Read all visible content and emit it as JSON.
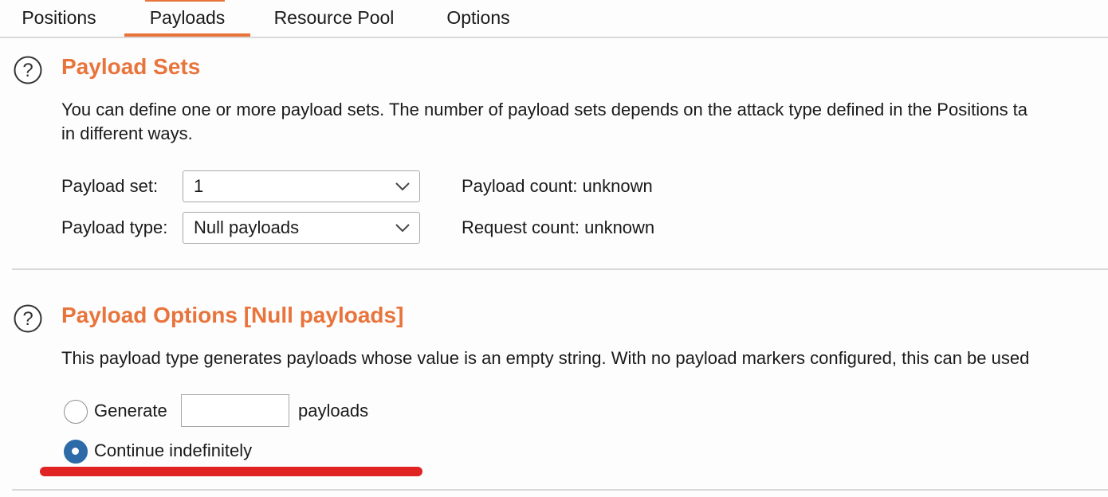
{
  "tabs": [
    {
      "label": "Positions",
      "active": false
    },
    {
      "label": "Payloads",
      "active": true
    },
    {
      "label": "Resource Pool",
      "active": false
    },
    {
      "label": "Options",
      "active": false
    }
  ],
  "payload_sets": {
    "title": "Payload Sets",
    "description_line1": "You can define one or more payload sets. The number of payload sets depends on the attack type defined in the Positions ta",
    "description_line2": "in different ways.",
    "payload_set_label": "Payload set:",
    "payload_set_value": "1",
    "payload_type_label": "Payload type:",
    "payload_type_value": "Null payloads",
    "payload_count_text": "Payload count:  unknown",
    "request_count_text": "Request count:  unknown"
  },
  "payload_options": {
    "title": "Payload Options [Null payloads]",
    "description": "This payload type generates payloads whose value is an empty string. With no payload markers configured, this can be used",
    "generate_label": "Generate",
    "generate_value": "",
    "payloads_suffix": "payloads",
    "continue_label": "Continue indefinitely",
    "selected_option": "continue_indefinitely"
  },
  "icons": {
    "help": "help-circle-icon",
    "dropdown": "chevron-down-icon"
  },
  "colors": {
    "accent": "#e8743b",
    "radio_selected": "#2c6aa8",
    "annotation": "#e02424"
  }
}
